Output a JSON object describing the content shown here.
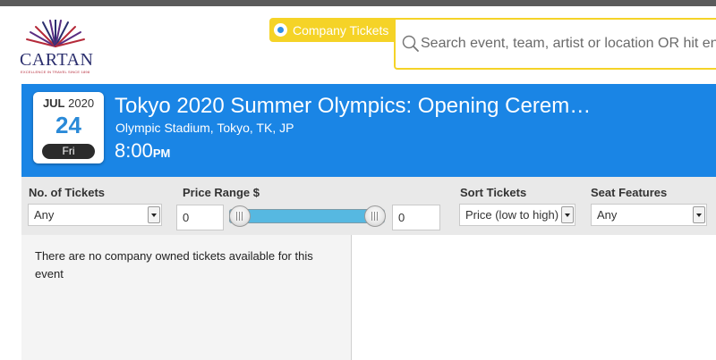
{
  "logo": {
    "brand": "CARTAN",
    "tagline": "EXCELLENCE IN TRAVEL SINCE 1898",
    "colors": {
      "navy": "#2b2f6e",
      "red": "#b52a3a",
      "purple": "#5a2d82"
    }
  },
  "search": {
    "mode_label": "Company Tickets",
    "placeholder": "Search event, team, artist or location OR hit enter to"
  },
  "event": {
    "month": "JUL",
    "year": "2020",
    "day": "24",
    "weekday": "Fri",
    "title": "Tokyo 2020 Summer Olympics: Opening Cerem…",
    "venue": "Olympic Stadium, Tokyo, TK, JP",
    "time": "8:00",
    "ampm": "PM"
  },
  "filters": {
    "num_tickets": {
      "label": "No. of Tickets",
      "value": "Any"
    },
    "price_range": {
      "label": "Price Range $",
      "min": "0",
      "max": "0"
    },
    "sort": {
      "label": "Sort Tickets",
      "value": "Price (low to high)"
    },
    "seat_features": {
      "label": "Seat Features",
      "value": "Any"
    }
  },
  "results": {
    "message": "There are no company owned tickets available for this event"
  },
  "colors": {
    "banner": "#1a85e5",
    "accent_yellow": "#f5d327",
    "slider": "#56b8e1",
    "topbar": "#5b5b5b"
  }
}
